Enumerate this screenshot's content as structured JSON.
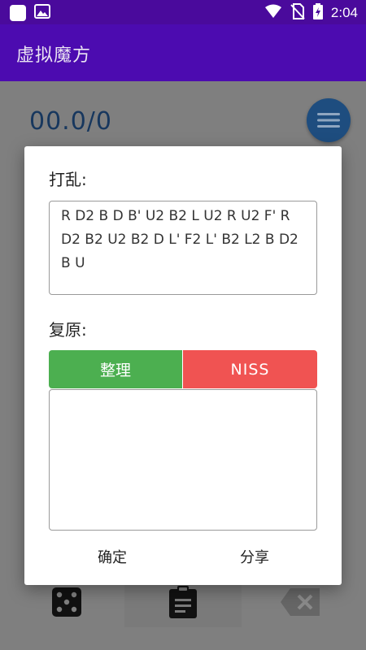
{
  "status_bar": {
    "time": "2:04",
    "icons": [
      "app-square-icon",
      "image-icon",
      "wifi-icon",
      "no-sim-icon",
      "battery-charging-icon"
    ]
  },
  "app_bar": {
    "title": "虚拟魔方"
  },
  "main": {
    "timer": "00.0/0",
    "menu_icon": "menu-icon"
  },
  "dialog": {
    "scramble_label": "打乱:",
    "scramble_text": "R D2 B D B' U2 B2 L U2 R U2 F' R D2 B2 U2 B2 D L' F2 L' B2 L2 B D2 B U",
    "solve_label": "复原:",
    "tidy_button": "整理",
    "niss_button": "NISS",
    "solve_text": "",
    "confirm_button": "确定",
    "share_button": "分享",
    "colors": {
      "tidy": "#4caf50",
      "niss": "#f05352"
    }
  },
  "toolbar": {
    "icons": [
      "dice-icon",
      "clipboard-icon",
      "backspace-icon"
    ]
  },
  "colors": {
    "app_bar": "#4c0bb0",
    "status_bar": "#4a0a9c",
    "fab": "#1e4d7f"
  }
}
